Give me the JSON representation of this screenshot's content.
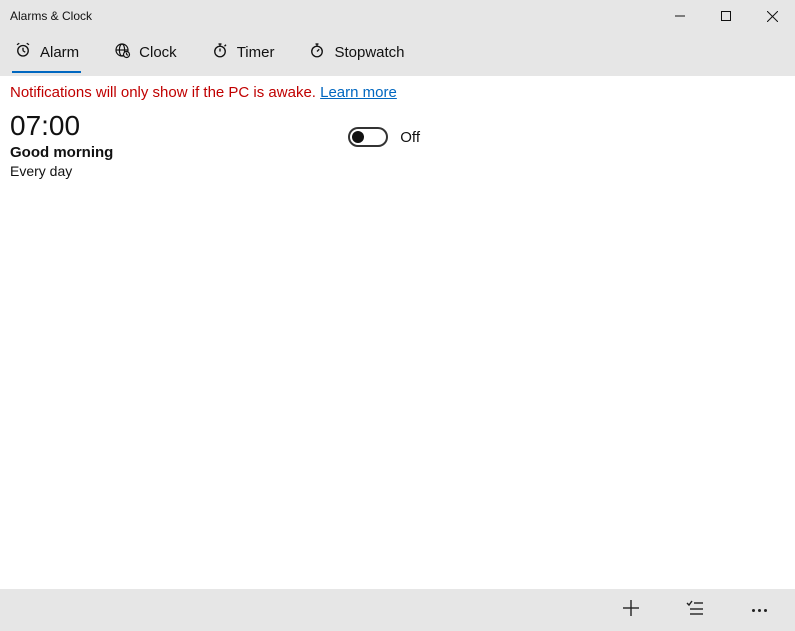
{
  "window": {
    "title": "Alarms & Clock"
  },
  "tabs": [
    {
      "label": "Alarm",
      "active": true
    },
    {
      "label": "Clock",
      "active": false
    },
    {
      "label": "Timer",
      "active": false
    },
    {
      "label": "Stopwatch",
      "active": false
    }
  ],
  "notification": {
    "message": "Notifications will only show if the PC is awake. ",
    "link_text": "Learn more"
  },
  "alarms": [
    {
      "time": "07:00",
      "name": "Good morning",
      "repeat": "Every day",
      "enabled": false,
      "toggle_label": "Off"
    }
  ],
  "commands": {
    "add": "Add new alarm",
    "select": "Select alarms",
    "more": "More"
  }
}
